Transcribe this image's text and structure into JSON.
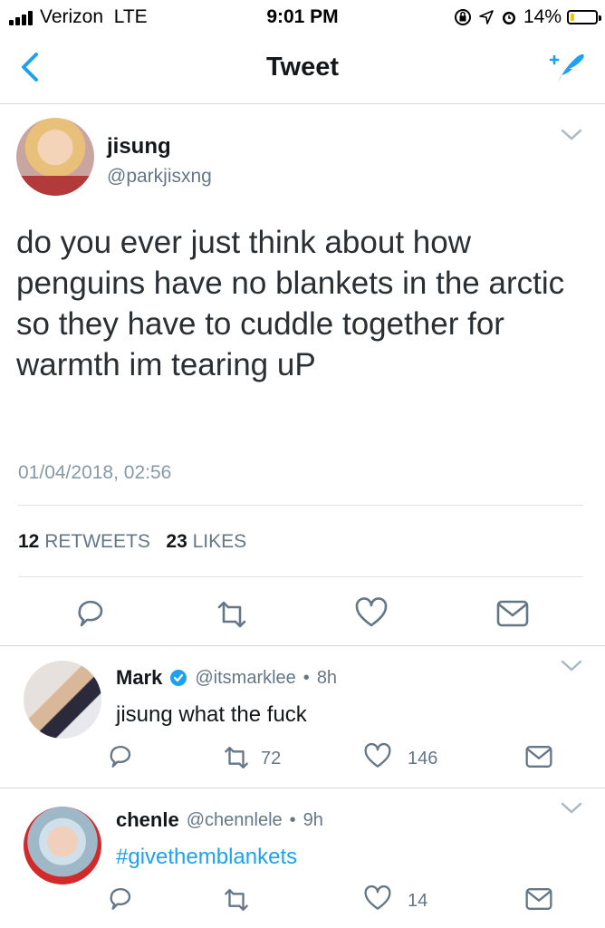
{
  "status_bar": {
    "carrier": "Verizon",
    "network": "LTE",
    "time": "9:01 PM",
    "battery": "14%",
    "battery_level": 0.14
  },
  "nav": {
    "title": "Tweet"
  },
  "tweet": {
    "name": "jisung",
    "handle": "@parkjisxng",
    "text": "do you ever just think about how penguins have no blankets in the arctic so they have to cuddle together for warmth im tearing uP",
    "date": "01/04/2018, 02:56",
    "retweets_count": "12",
    "retweets_label": "RETWEETS",
    "likes_count": "23",
    "likes_label": "LIKES"
  },
  "replies": [
    {
      "name": "Mark",
      "verified": true,
      "handle": "@itsmarklee",
      "time": "8h",
      "text": "jisung what the fuck",
      "retweets": "72",
      "likes": "146"
    },
    {
      "name": "chenle",
      "verified": false,
      "handle": "@chennlele",
      "time": "9h",
      "text": "#givethemblankets",
      "retweets": "",
      "likes": "14"
    }
  ],
  "colors": {
    "accent": "#1da1f2",
    "verified": "#1da1f2",
    "secondary_text": "#657786",
    "battery_low": "#f5c200"
  },
  "icons": [
    "back-chevron-icon",
    "compose-tweet-icon",
    "chevron-down-icon",
    "reply-icon",
    "retweet-icon",
    "like-icon",
    "direct-message-icon",
    "verified-icon",
    "alarm-icon",
    "location-icon",
    "orientation-lock-icon"
  ]
}
